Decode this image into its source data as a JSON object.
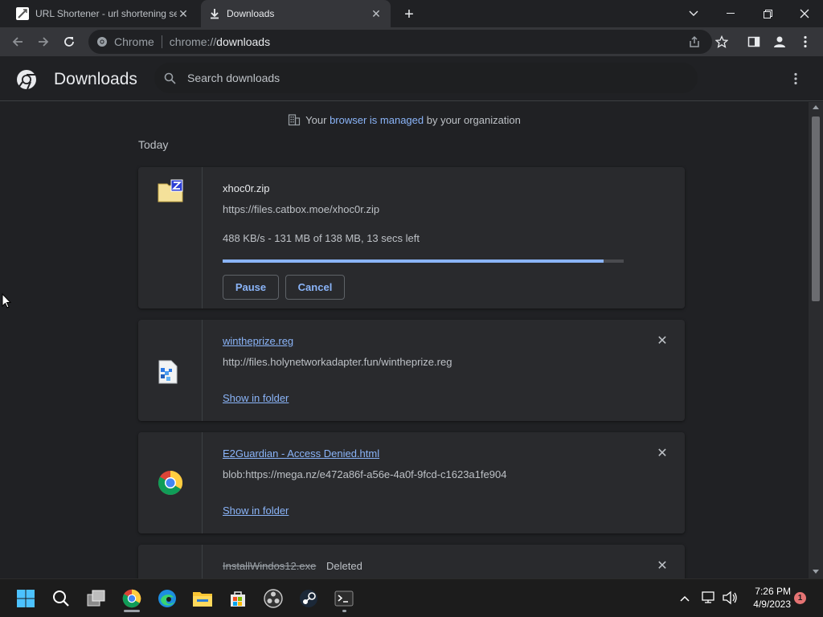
{
  "tabs": [
    {
      "title": "URL Shortener - url shortening se",
      "icon": "url-shortener-favicon",
      "active": false
    },
    {
      "title": "Downloads",
      "icon": "download-icon",
      "active": true
    }
  ],
  "omnibox": {
    "site_label": "Chrome",
    "url_prefix": "chrome://",
    "url_path": "downloads"
  },
  "header": {
    "title": "Downloads",
    "search_placeholder": "Search downloads"
  },
  "managed": {
    "prefix": "Your ",
    "link": "browser is managed",
    "suffix": " by your organization"
  },
  "section_label": "Today",
  "downloads": [
    {
      "filename": "xhoc0r.zip",
      "url": "https://files.catbox.moe/xhoc0r.zip",
      "status": "488 KB/s - 131 MB of 138 MB, 13 secs left",
      "progress": 0.949,
      "pause_label": "Pause",
      "cancel_label": "Cancel"
    },
    {
      "filename": "wintheprize.reg",
      "url": "http://files.holynetworkadapter.fun/wintheprize.reg",
      "action_label": "Show in folder"
    },
    {
      "filename": "E2Guardian - Access Denied.html",
      "url": "blob:https://mega.nz/e472a86f-a56e-4a0f-9fcd-c1623a1fe904",
      "action_label": "Show in folder"
    },
    {
      "filename": "InstallWindos12.exe",
      "tag": "Deleted"
    }
  ],
  "taskbar": {
    "time": "7:26 PM",
    "date": "4/9/2023",
    "notification_count": "1"
  },
  "colors": {
    "accent": "#8ab4f8",
    "background": "#202124",
    "card": "#292a2d"
  }
}
